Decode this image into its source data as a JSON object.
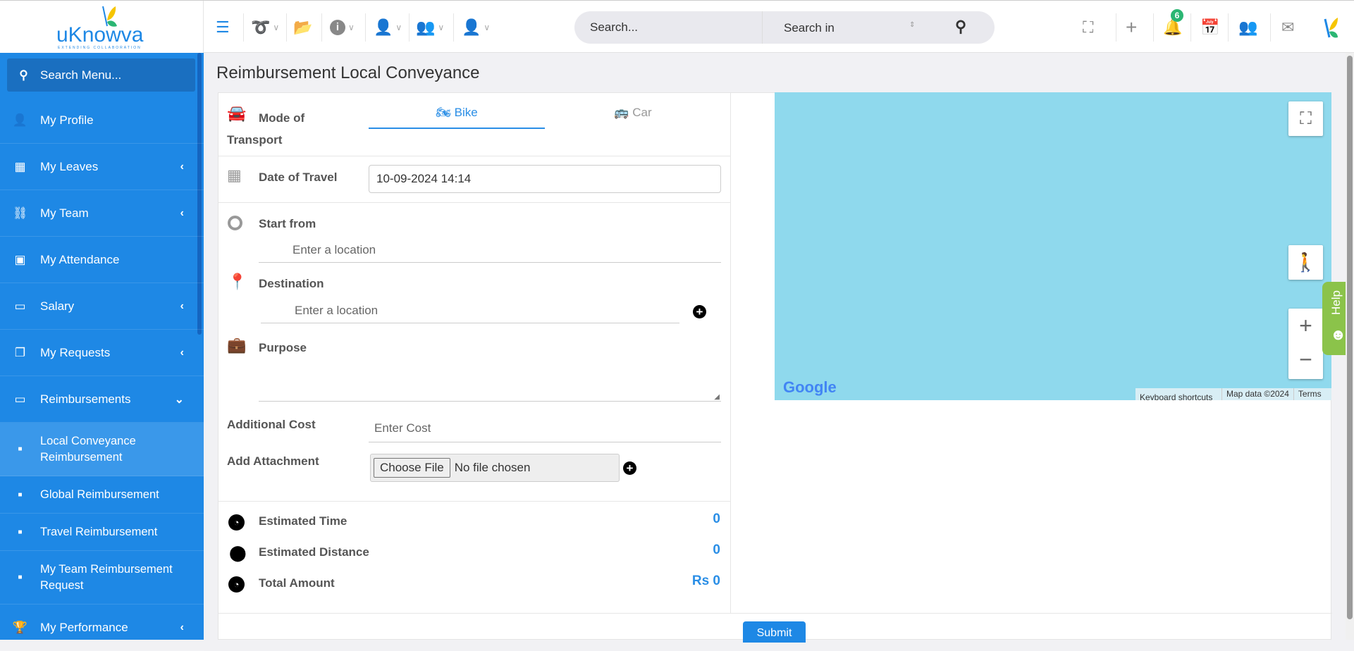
{
  "header": {
    "logo_text": "uKnowva",
    "logo_tagline": "EXTENDING COLLABORATION",
    "search_placeholder": "Search...",
    "search_in": "Search in",
    "notification_count": "6"
  },
  "sidebar": {
    "search_label": "Search Menu...",
    "items": [
      {
        "label": "My Profile"
      },
      {
        "label": "My Leaves"
      },
      {
        "label": "My Team"
      },
      {
        "label": "My Attendance"
      },
      {
        "label": "Salary"
      },
      {
        "label": "My Requests"
      },
      {
        "label": "Reimbursements"
      },
      {
        "label": "My Performance"
      }
    ],
    "subitems": [
      {
        "label": "Local Conveyance Reimbursement"
      },
      {
        "label": "Global Reimbursement"
      },
      {
        "label": "Travel Reimbursement"
      },
      {
        "label": "My Team Reimbursement Request"
      }
    ]
  },
  "page": {
    "title": "Reimbursement Local Conveyance"
  },
  "form": {
    "mode_label": "Mode of Transport",
    "tab_bike": "Bike",
    "tab_car": "Car",
    "date_label": "Date of Travel",
    "date_value": "10-09-2024 14:14",
    "start_label": "Start from",
    "start_placeholder": "Enter a location",
    "dest_label": "Destination",
    "dest_placeholder": "Enter a location",
    "purpose_label": "Purpose",
    "cost_label": "Additional Cost",
    "cost_placeholder": "Enter Cost",
    "attach_label": "Add Attachment",
    "choose_file": "Choose File",
    "no_file": "No file chosen",
    "est_time_label": "Estimated Time",
    "est_time_value": "0",
    "est_dist_label": "Estimated Distance",
    "est_dist_value": "0",
    "total_label": "Total Amount",
    "total_value": "Rs 0",
    "submit": "Submit"
  },
  "map": {
    "google": "Google",
    "shortcuts": "Keyboard shortcuts",
    "map_data": "Map data ©2024",
    "terms": "Terms"
  },
  "help": {
    "label": "Help"
  },
  "colors": {
    "primary": "#1e88e5",
    "accent": "#2a8ee6",
    "map": "#8fd9ed",
    "help": "#8bc34a"
  }
}
